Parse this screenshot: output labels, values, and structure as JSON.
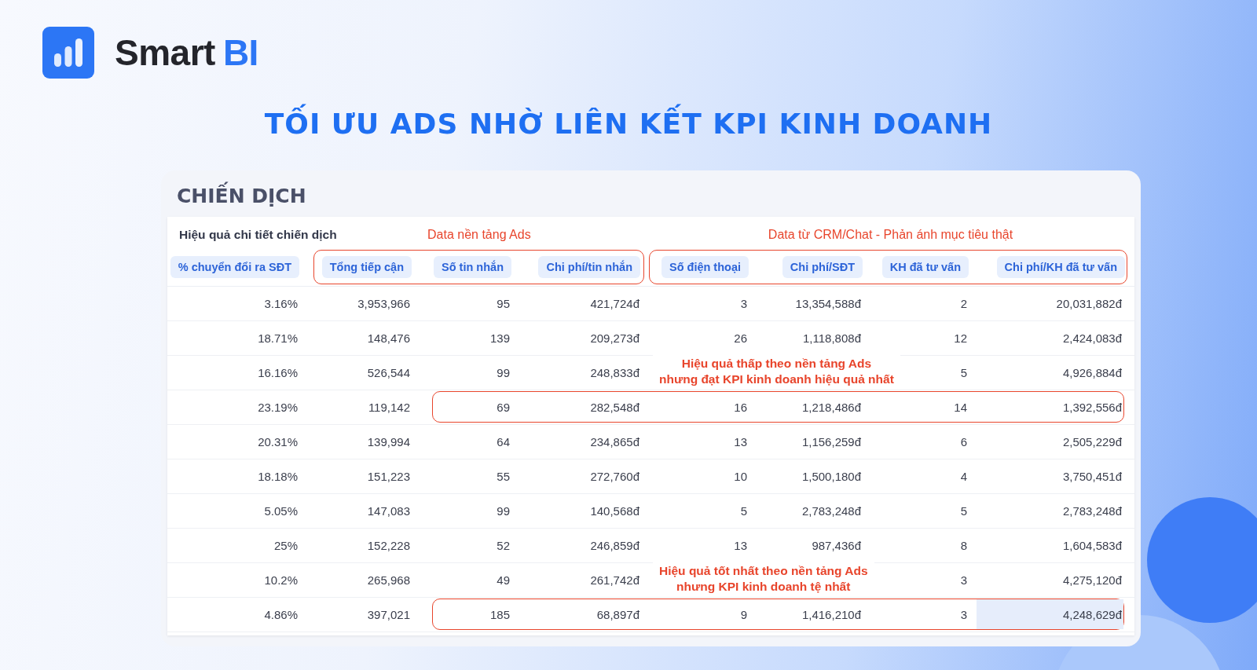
{
  "brand": {
    "name": "Smart",
    "accent": "BI"
  },
  "headline": "TỐI ƯU ADS NHỜ LIÊN KẾT KPI KINH DOANH",
  "card": {
    "title": "CHIẾN DỊCH",
    "subtitle": "Hiệu quả chi tiết chiến dịch",
    "groups": [
      {
        "label": "Data nền tảng Ads",
        "outlined": true,
        "columns": [
          "Tổng tiếp cận",
          "Số tin nhắn",
          "Chi phí/tin nhắn"
        ]
      },
      {
        "label": "Data từ CRM/Chat - Phản ánh mục tiêu thật",
        "outlined": true,
        "columns": [
          "Số điện thoại",
          "Chi phí/SĐT",
          "KH đã tư vấn",
          "Chi phí/KH đã tư vấn"
        ]
      }
    ],
    "first_column": "% chuyển đổi ra SĐT",
    "rows": [
      {
        "values": [
          "3.16%",
          "3,953,966",
          "95",
          "421,724đ",
          "3",
          "13,354,588đ",
          "2",
          "20,031,882đ"
        ],
        "outlined": false,
        "last_cell_shaded": false
      },
      {
        "values": [
          "18.71%",
          "148,476",
          "139",
          "209,273đ",
          "26",
          "1,118,808đ",
          "12",
          "2,424,083đ"
        ],
        "outlined": false,
        "last_cell_shaded": false
      },
      {
        "values": [
          "16.16%",
          "526,544",
          "99",
          "248,833đ",
          "5",
          "4,926,884đ"
        ],
        "covered_by_note": true,
        "outlined": false,
        "last_cell_shaded": false
      },
      {
        "values": [
          "23.19%",
          "119,142",
          "69",
          "282,548đ",
          "16",
          "1,218,486đ",
          "14",
          "1,392,556đ"
        ],
        "outlined": true,
        "last_cell_shaded": false,
        "note": [
          "Hiệu quả thấp theo nền tảng Ads",
          "nhưng đạt KPI kinh doanh hiệu quả nhất"
        ]
      },
      {
        "values": [
          "20.31%",
          "139,994",
          "64",
          "234,865đ",
          "13",
          "1,156,259đ",
          "6",
          "2,505,229đ"
        ],
        "outlined": false,
        "last_cell_shaded": false
      },
      {
        "values": [
          "18.18%",
          "151,223",
          "55",
          "272,760đ",
          "10",
          "1,500,180đ",
          "4",
          "3,750,451đ"
        ],
        "outlined": false,
        "last_cell_shaded": false
      },
      {
        "values": [
          "5.05%",
          "147,083",
          "99",
          "140,568đ",
          "5",
          "2,783,248đ",
          "5",
          "2,783,248đ"
        ],
        "outlined": false,
        "last_cell_shaded": false
      },
      {
        "values": [
          "25%",
          "152,228",
          "52",
          "246,859đ",
          "13",
          "987,436đ",
          "8",
          "1,604,583đ"
        ],
        "outlined": false,
        "last_cell_shaded": false
      },
      {
        "values": [
          "10.2%",
          "265,968",
          "49",
          "261,742đ",
          "3",
          "4,275,120đ"
        ],
        "covered_by_note": true,
        "outlined": false,
        "last_cell_shaded": false
      },
      {
        "values": [
          "4.86%",
          "397,021",
          "185",
          "68,897đ",
          "9",
          "1,416,210đ",
          "3",
          "4,248,629đ"
        ],
        "outlined": true,
        "last_cell_shaded": true,
        "note": [
          "Hiệu quả tốt nhất theo nền tảng Ads",
          "nhưng KPI kinh doanh tệ nhất"
        ]
      }
    ]
  }
}
